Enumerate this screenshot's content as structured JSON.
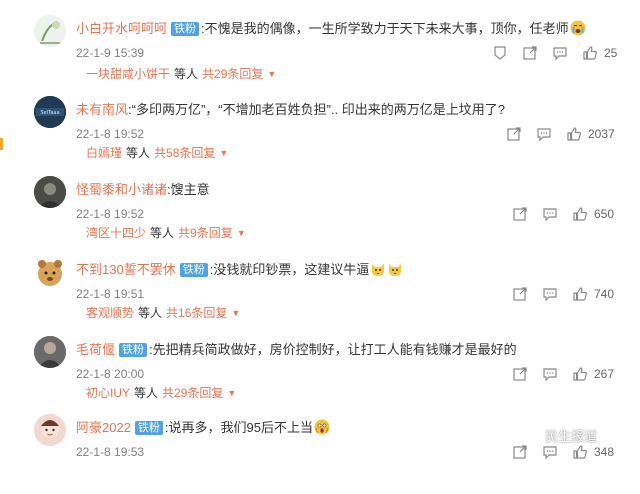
{
  "badge_label": "铁粉",
  "watermark_text": "民生报道",
  "comments": [
    {
      "username": "小白开水呵呵呵",
      "badge": true,
      "text": ":不愧是我的偶像，一生所学致力于天下未来大事，顶你，任老师",
      "emoji": "crying-face-emoji",
      "time": "22-1-9 15:39",
      "likes": "25",
      "reply_user": "一块甜咸小饼干",
      "reply_mid": "等人",
      "reply_count": "共29条回复"
    },
    {
      "username": "未有南风",
      "badge": false,
      "text": ":“多印两万亿”，“不增加老百姓负担”.. 印出来的两万亿是上坟用了?",
      "emoji": "",
      "time": "22-1-8 19:52",
      "likes": "2037",
      "reply_user": "白嫣瑾",
      "reply_mid": "等人",
      "reply_count": "共58条回复"
    },
    {
      "username": "怪蜀黍和小诸诸",
      "badge": false,
      "text": ":馊主意",
      "emoji": "",
      "time": "22-1-8 19:52",
      "likes": "650",
      "reply_user": "湾区十四少",
      "reply_mid": "等人",
      "reply_count": "共9条回复"
    },
    {
      "username": "不到130誓不罢休",
      "badge": true,
      "text": ":没钱就印钞票，这建议牛逼",
      "emoji": "cat-face-emoji",
      "time": "22-1-8 19:51",
      "likes": "740",
      "reply_user": "客观顺势",
      "reply_mid": "等人",
      "reply_count": "共16条回复"
    },
    {
      "username": "毛荷偃",
      "badge": true,
      "text": ":先把精兵简政做好，房价控制好，让打工人能有钱赚才是最好的",
      "emoji": "",
      "time": "22-1-8 20:00",
      "likes": "267",
      "reply_user": "初心IUY",
      "reply_mid": "等人",
      "reply_count": "共29条回复"
    },
    {
      "username": "阿豪2022",
      "badge": true,
      "text": ":说再多，我们95后不上当",
      "emoji": "scream-face-emoji",
      "time": "22-1-8 19:53",
      "likes": "348",
      "reply_user": "",
      "reply_mid": "",
      "reply_count": ""
    }
  ]
}
